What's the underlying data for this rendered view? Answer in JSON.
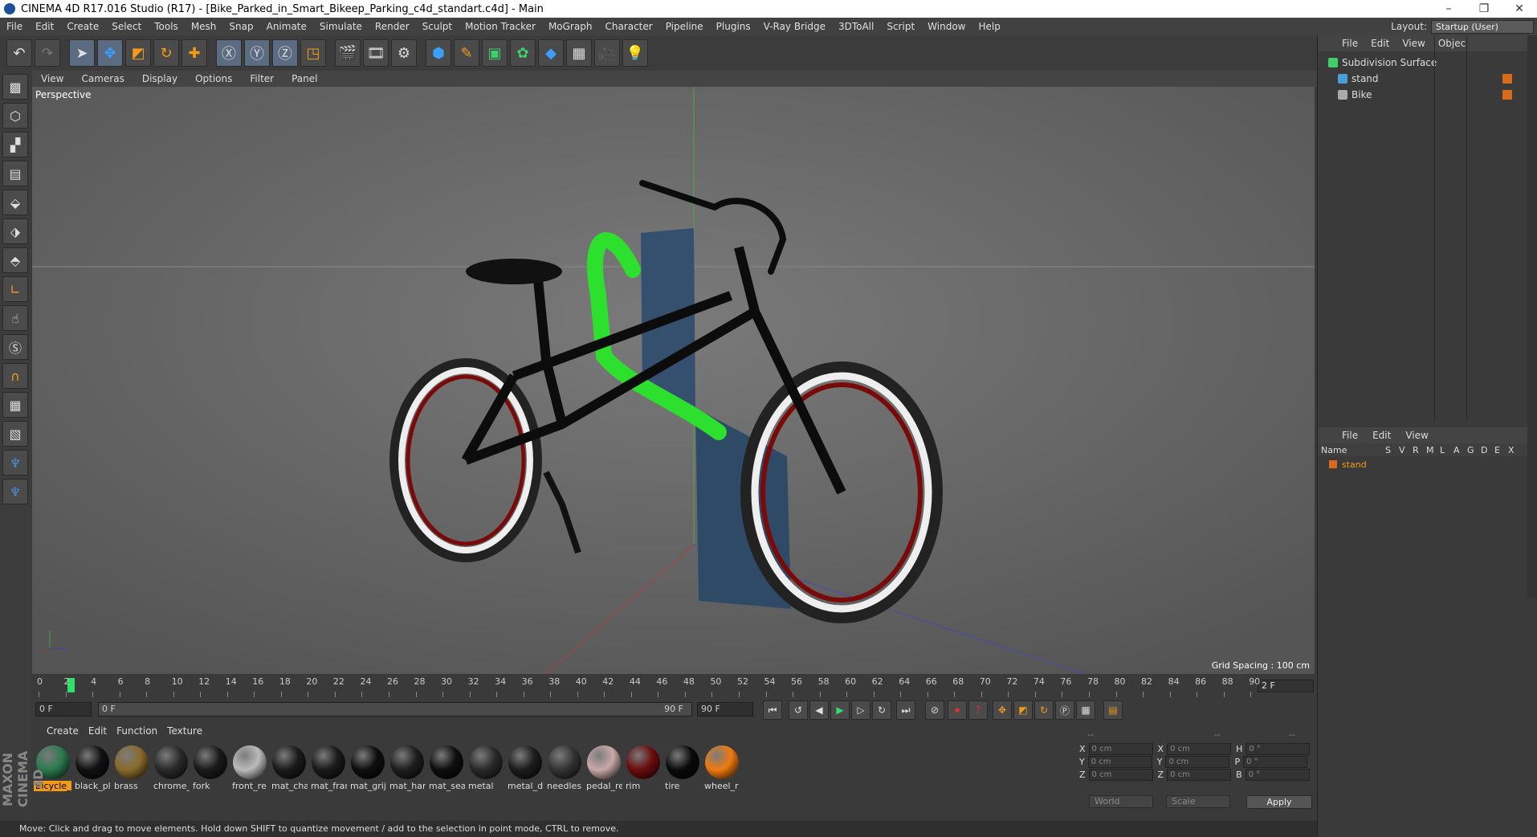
{
  "window": {
    "title": "CINEMA 4D R17.016 Studio (R17) - [Bike_Parked_in_Smart_Bikeep_Parking_c4d_standart.c4d] - Main"
  },
  "menu": [
    "File",
    "Edit",
    "Create",
    "Select",
    "Tools",
    "Mesh",
    "Snap",
    "Animate",
    "Simulate",
    "Render",
    "Sculpt",
    "Motion Tracker",
    "MoGraph",
    "Character",
    "Pipeline",
    "Plugins",
    "V-Ray Bridge",
    "3DToAll",
    "Script",
    "Window",
    "Help"
  ],
  "layout": {
    "label": "Layout:",
    "value": "Startup (User)"
  },
  "viewport": {
    "menu": [
      "View",
      "Cameras",
      "Display",
      "Options",
      "Filter",
      "Panel"
    ],
    "label": "Perspective",
    "grid_spacing": "Grid Spacing : 100 cm"
  },
  "timeline": {
    "ticks": [
      "0",
      "2",
      "4",
      "6",
      "8",
      "10",
      "12",
      "14",
      "16",
      "18",
      "20",
      "22",
      "24",
      "26",
      "28",
      "30",
      "32",
      "34",
      "36",
      "38",
      "40",
      "42",
      "44",
      "46",
      "48",
      "50",
      "52",
      "54",
      "56",
      "58",
      "60",
      "62",
      "64",
      "66",
      "68",
      "70",
      "72",
      "74",
      "76",
      "78",
      "80",
      "82",
      "84",
      "86",
      "88",
      "90"
    ],
    "current": "2 F",
    "start_field": "0 F",
    "range_start": "0 F",
    "range_end": "90 F",
    "end_field": "90 F"
  },
  "materials": {
    "menu": [
      "Create",
      "Edit",
      "Function",
      "Texture"
    ],
    "items": [
      {
        "name": "Bicycle_I",
        "color": "#2a7a4f"
      },
      {
        "name": "black_pl",
        "color": "#111111"
      },
      {
        "name": "brass",
        "color": "#8a6a2a"
      },
      {
        "name": "chrome_",
        "color": "#2a2a2a"
      },
      {
        "name": "fork",
        "color": "#1a1a1a"
      },
      {
        "name": "front_re",
        "color": "#bbbbbb"
      },
      {
        "name": "mat_cha",
        "color": "#1a1a1a"
      },
      {
        "name": "mat_frar",
        "color": "#1a1a1a"
      },
      {
        "name": "mat_grij",
        "color": "#0e0e0e"
      },
      {
        "name": "mat_har",
        "color": "#1e1e1e"
      },
      {
        "name": "mat_sea",
        "color": "#0e0e0e"
      },
      {
        "name": "metal",
        "color": "#2a2a2a"
      },
      {
        "name": "metal_d",
        "color": "#1c1c1c"
      },
      {
        "name": "needles",
        "color": "#333333"
      },
      {
        "name": "pedal_re",
        "color": "#c8a8a8"
      },
      {
        "name": "rim",
        "color": "#6a0c0c"
      },
      {
        "name": "tire",
        "color": "#0a0a0a"
      },
      {
        "name": "wheel_r",
        "color": "#f07a10"
      }
    ]
  },
  "coords": {
    "headers": [
      "--",
      "--",
      "--"
    ],
    "rows": [
      {
        "a": "X",
        "av": "0 cm",
        "b": "X",
        "bv": "0 cm",
        "c": "H",
        "cv": "0 °"
      },
      {
        "a": "Y",
        "av": "0 cm",
        "b": "Y",
        "bv": "0 cm",
        "c": "P",
        "cv": "0 °"
      },
      {
        "a": "Z",
        "av": "0 cm",
        "b": "Z",
        "bv": "0 cm",
        "c": "B",
        "cv": "0 °"
      }
    ],
    "mode": "World",
    "size_mode": "Scale",
    "apply": "Apply"
  },
  "object_manager": {
    "menu": [
      "File",
      "Edit",
      "View",
      "Objec"
    ],
    "objects": [
      {
        "name": "Subdivision Surface"
      },
      {
        "name": "stand"
      },
      {
        "name": "Bike"
      }
    ]
  },
  "layer_manager": {
    "menu": [
      "File",
      "Edit",
      "View"
    ],
    "columns": [
      "Name",
      "S",
      "V",
      "R",
      "M",
      "L",
      "A",
      "G",
      "D",
      "E",
      "X"
    ],
    "rows": [
      {
        "name": "stand"
      }
    ]
  },
  "status": "Move: Click and drag to move elements. Hold down SHIFT to quantize movement / add to the selection in point mode, CTRL to remove.",
  "branding": "MAXON CINEMA 4D",
  "colors": {
    "accent": "#f29b1a",
    "selection": "#2fdf6a",
    "bike_rack": "#2de02d"
  }
}
